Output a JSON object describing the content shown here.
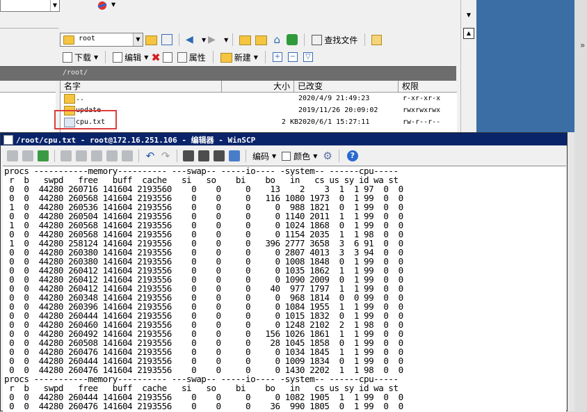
{
  "main_window": {
    "toolbar1": {
      "path_combo": "root",
      "find_files_label": "查找文件"
    },
    "toolbar2": {
      "download_label": "下载",
      "edit_label": "编辑",
      "properties_label": "属性",
      "new_label": "新建"
    },
    "path": "/root/",
    "columns": [
      "名字",
      "大小",
      "已改变",
      "权限"
    ],
    "files": [
      {
        "name": "..",
        "size": "",
        "modified": "2020/4/9 21:49:23",
        "perms": "r-xr-xr-x",
        "icon": "parent-folder-icon"
      },
      {
        "name": "update",
        "size": "",
        "modified": "2019/11/26 20:09:02",
        "perms": "rwxrwxrwx",
        "icon": "folder-icon"
      },
      {
        "name": "cpu.txt",
        "size": "2 KB",
        "modified": "2020/6/1 15:27:11",
        "perms": "rw-r--r--",
        "icon": "file-icon"
      }
    ]
  },
  "editor": {
    "title": "/root/cpu.txt - root@172.16.251.106 - 编辑器 - WinSCP",
    "encoding_label": "编码",
    "color_label": "颜色",
    "lines": [
      "procs -----------memory---------- ---swap-- -----io---- -system-- ------cpu-----",
      " r  b   swpd   free   buff  cache   si   so    bi    bo   in   cs us sy id wa st",
      " 0  0  44280 260716 141604 2193560    0    0     0    13    2    3  1  1 97  0  0",
      " 0  0  44280 260568 141604 2193556    0    0     0   116 1080 1973  0  1 99  0  0",
      " 1  0  44280 260536 141604 2193556    0    0     0     0  988 1821  0  1 99  0  0",
      " 0  0  44280 260504 141604 2193556    0    0     0     0 1140 2011  1  1 99  0  0",
      " 1  0  44280 260568 141604 2193556    0    0     0     0 1024 1868  0  1 99  0  0",
      " 0  0  44280 260568 141604 2193556    0    0     0     0 1154 2035  1  1 98  0  0",
      " 1  0  44280 258124 141604 2193556    0    0     0   396 2777 3658  3  6 91  0  0",
      " 0  0  44280 260380 141604 2193556    0    0     0     0 2807 4013  3  3 94  0  0",
      " 0  0  44280 260380 141604 2193556    0    0     0     0 1008 1848  0  1 99  0  0",
      " 0  0  44280 260412 141604 2193556    0    0     0     0 1035 1862  1  1 99  0  0",
      " 0  0  44280 260412 141604 2193556    0    0     0     0 1090 2009  0  1 99  0  0",
      " 0  0  44280 260412 141604 2193556    0    0     0    40  977 1797  1  1 99  0  0",
      " 0  0  44280 260348 141604 2193556    0    0     0     0  968 1814  0  0 99  0  0",
      " 0  0  44280 260396 141604 2193556    0    0     0     0 1084 1955  1  1 99  0  0",
      " 0  0  44280 260444 141604 2193556    0    0     0     0 1015 1832  0  1 99  0  0",
      " 0  0  44280 260460 141604 2193556    0    0     0     0 1248 2102  2  1 98  0  0",
      " 0  0  44280 260492 141604 2193556    0    0     0   156 1026 1861  1  1 99  0  0",
      " 0  0  44280 260508 141604 2193556    0    0     0    28 1045 1858  0  1 99  0  0",
      " 0  0  44280 260476 141604 2193556    0    0     0     0 1034 1845  1  1 99  0  0",
      " 0  0  44280 260444 141604 2193556    0    0     0     0 1009 1834  0  1 99  0  0",
      " 0  0  44280 260476 141604 2193556    0    0     0     0 1430 2202  1  1 98  0  0",
      "procs -----------memory---------- ---swap-- -----io---- -system-- ------cpu-----",
      " r  b   swpd   free   buff  cache   si   so    bi    bo   in   cs us sy id wa st",
      " 0  0  44280 260444 141604 2193556    0    0     0     0 1082 1905  1  1 99  0  0",
      " 0  0  44280 260476 141604 2193556    0    0     0    36  990 1805  0  1 99  0  0"
    ]
  }
}
